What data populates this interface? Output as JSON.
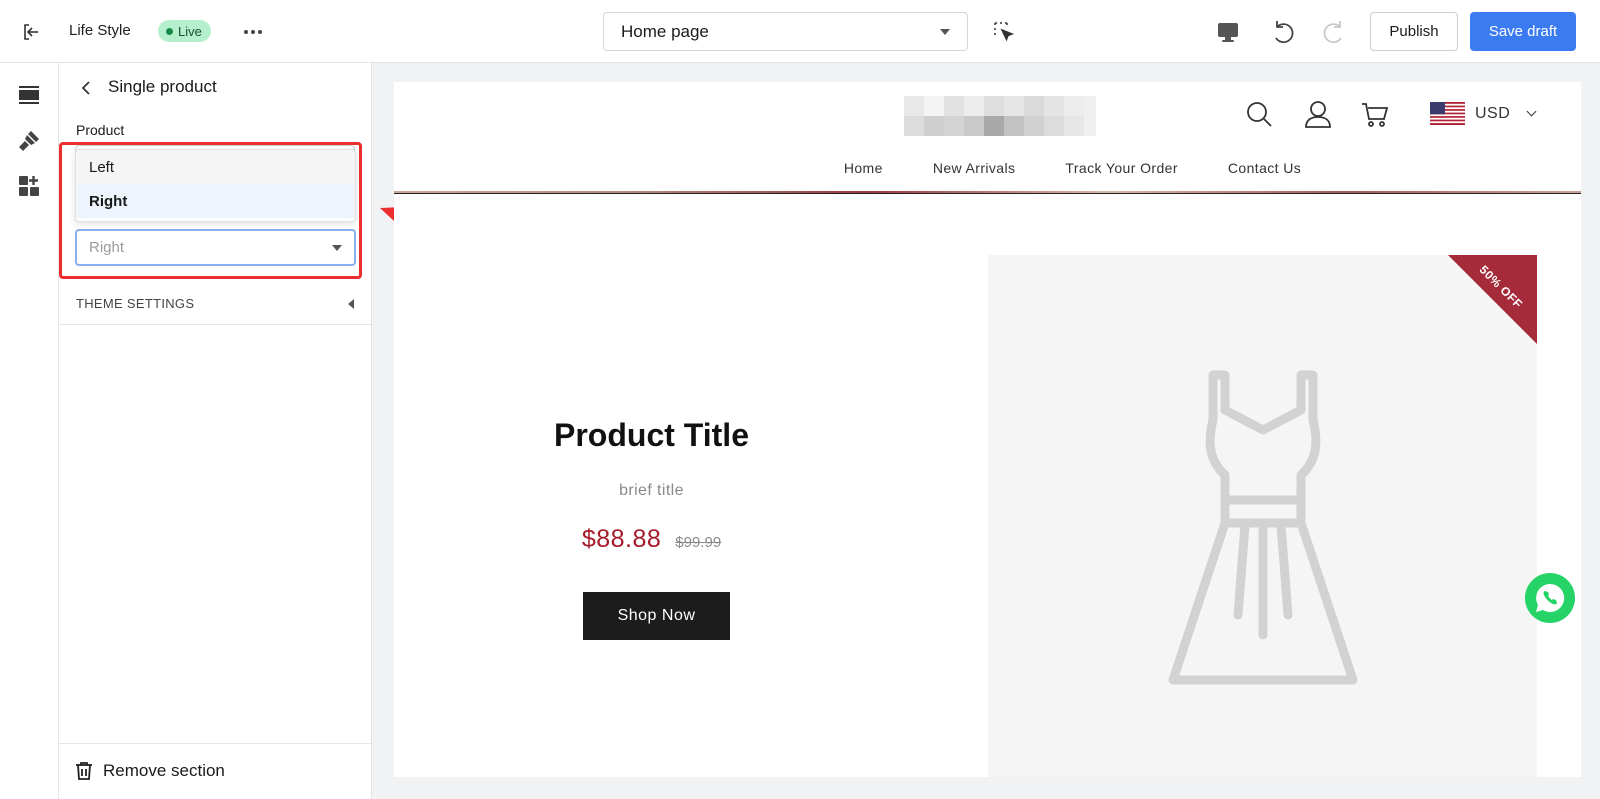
{
  "topbar": {
    "store_name": "Life Style",
    "status_badge": "Live",
    "page_selector": "Home page",
    "publish_label": "Publish",
    "save_label": "Save draft"
  },
  "panel": {
    "title": "Single product",
    "field_label": "Product",
    "dropdown_options": [
      "Left",
      "Right"
    ],
    "dropdown_selected": "Right",
    "layout_value": "Right",
    "theme_settings": "THEME SETTINGS",
    "remove_section": "Remove section"
  },
  "preview": {
    "currency": "USD",
    "nav": [
      "Home",
      "New Arrivals",
      "Track Your Order",
      "Contact Us"
    ],
    "product_title": "Product Title",
    "brief_title": "brief title",
    "price": "$88.88",
    "compare_price": "$99.99",
    "shop_button": "Shop Now",
    "discount_badge": "50% OFF"
  },
  "colors": {
    "accent": "#3b7bf2",
    "price": "#a51b2a",
    "highlight": "#ee2e2e",
    "badge": "#a52a3a",
    "whatsapp": "#25d366"
  },
  "icons": [
    "exit-icon",
    "more-icon",
    "select-element-icon",
    "desktop-icon",
    "undo-icon",
    "redo-icon",
    "sections-icon",
    "theme-brush-icon",
    "apps-icon",
    "back-arrow-icon",
    "trash-icon",
    "search-icon",
    "account-icon",
    "cart-icon",
    "us-flag-icon",
    "whatsapp-icon"
  ]
}
